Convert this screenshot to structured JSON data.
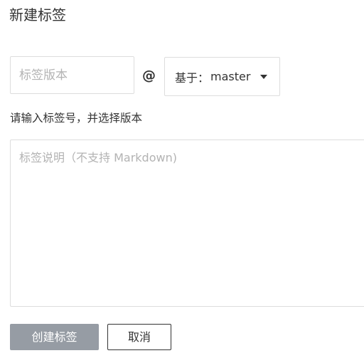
{
  "page": {
    "title": "新建标签"
  },
  "tag_form": {
    "tag_input_placeholder": "标签版本",
    "tag_input_value": "",
    "at_symbol": "@",
    "branch_prefix": "基于：",
    "branch_value": "master",
    "hint": "请输入标签号，并选择版本",
    "description_placeholder": "标签说明（不支持 Markdown)",
    "description_value": ""
  },
  "actions": {
    "create_label": "创建标签",
    "cancel_label": "取消"
  },
  "colors": {
    "primary_button_bg": "#969ca4",
    "border": "#dddddd",
    "placeholder": "#b3b3b3",
    "text": "#333333"
  },
  "icons": {
    "branch_dropdown": "caret-down-icon"
  }
}
